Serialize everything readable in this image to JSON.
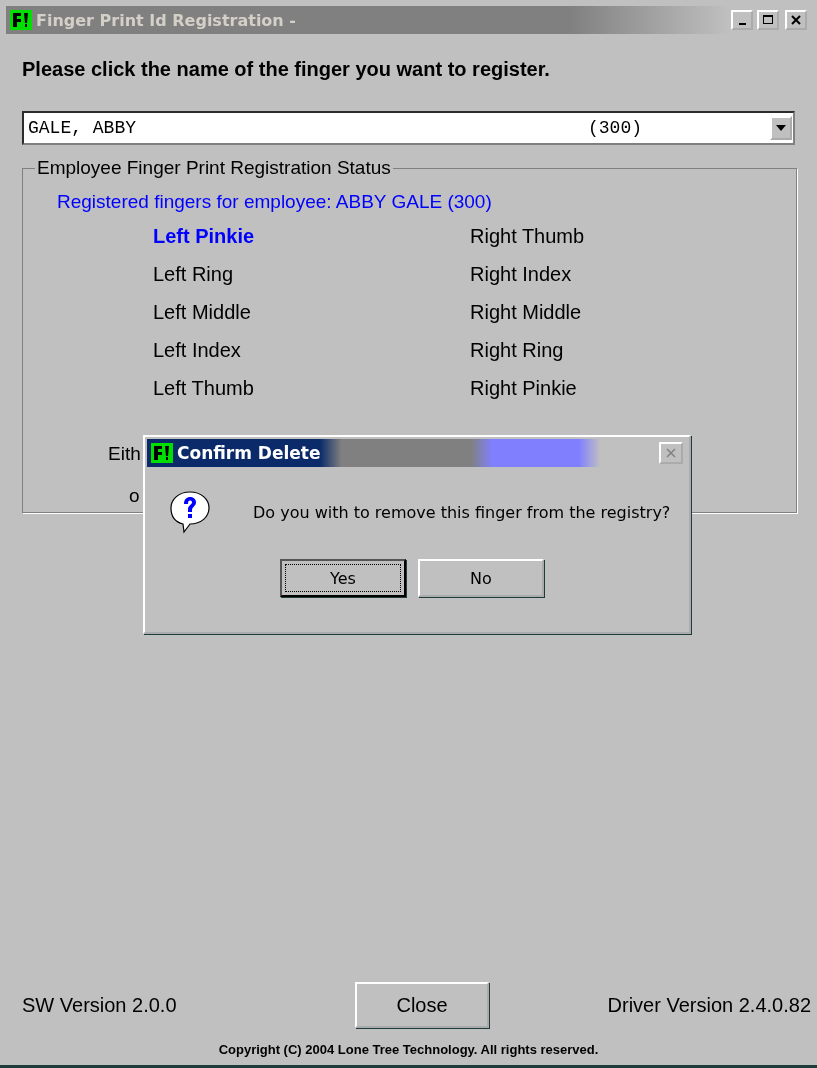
{
  "window": {
    "title": "Finger Print Id Registration -",
    "active": false
  },
  "instruction": "Please click the name of the finger you want to register.",
  "employee_select": {
    "value": "GALE, ABBY",
    "code": "(300)"
  },
  "status_group": {
    "title": "Employee Finger Print Registration Status",
    "registered_label": "Registered fingers for employee:  ABBY GALE   (300)",
    "fingers": [
      {
        "label": "Left Pinkie",
        "selected": true
      },
      {
        "label": "Right Thumb",
        "selected": false
      },
      {
        "label": "Left Ring",
        "selected": false
      },
      {
        "label": "Right Index",
        "selected": false
      },
      {
        "label": "Left Middle",
        "selected": false
      },
      {
        "label": "Right Middle",
        "selected": false
      },
      {
        "label": "Left Index",
        "selected": false
      },
      {
        "label": "Right Ring",
        "selected": false
      },
      {
        "label": "Left Thumb",
        "selected": false
      },
      {
        "label": "Right Pinkie",
        "selected": false
      }
    ],
    "notes": [
      "Eith",
      "o"
    ]
  },
  "dialog": {
    "title": "Confirm Delete",
    "message": "Do you with to remove this finger from the registry?",
    "buttons": [
      {
        "label": "Yes",
        "selected": true
      },
      {
        "label": "No",
        "selected": false
      }
    ]
  },
  "footer": {
    "sw_version": "SW Version 2.0.0",
    "close_button": "Close",
    "driver_version": "Driver Version 2.4.0.82",
    "copyright": "Copyright (C) 2004   Lone Tree Technology.  All rights reserved."
  }
}
